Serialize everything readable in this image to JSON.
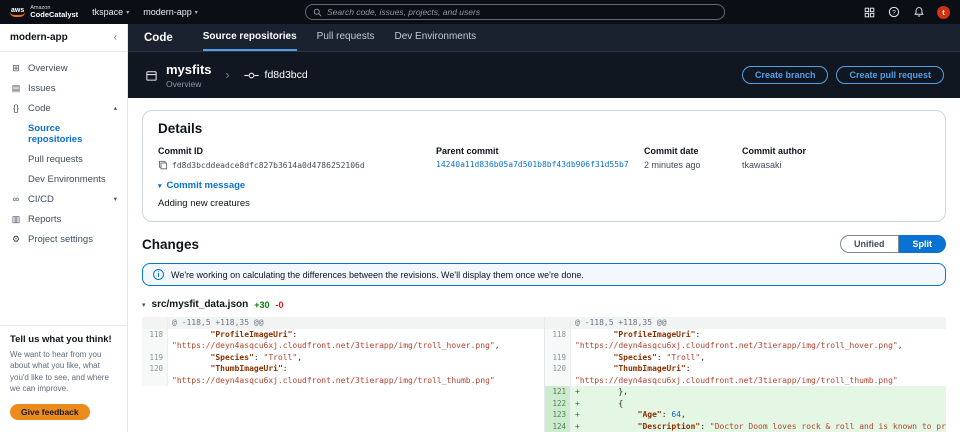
{
  "topbar": {
    "brand_top": "Amazon",
    "brand_bottom": "CodeCatalyst",
    "workspace": "tkspace",
    "project": "modern-app",
    "search_placeholder": "Search code, issues, projects, and users",
    "avatar_letter": "t"
  },
  "icons": {
    "chevron_down": "▾",
    "chevron_up": "▴",
    "collapse_left": "‹",
    "crumb_sep": "›",
    "expander_caret": "▾",
    "info_letter": "i",
    "overview": "⊞",
    "issues": "▤",
    "code": "{}",
    "cicd": "∞",
    "reports": "▥",
    "settings": "⚙"
  },
  "sidebar": {
    "project_name": "modern-app",
    "items": [
      {
        "label": "Overview",
        "icon": "overview"
      },
      {
        "label": "Issues",
        "icon": "issues"
      },
      {
        "label": "Code",
        "icon": "code",
        "caret": "up"
      },
      {
        "label": "Source repositories",
        "indent": true,
        "active": true
      },
      {
        "label": "Pull requests",
        "indent": true
      },
      {
        "label": "Dev Environments",
        "indent": true
      },
      {
        "label": "CI/CD",
        "icon": "cicd",
        "caret": "down"
      },
      {
        "label": "Reports",
        "icon": "reports"
      },
      {
        "label": "Project settings",
        "icon": "settings"
      }
    ],
    "feedback": {
      "title": "Tell us what you think!",
      "body": "We want to hear from you about what you like, what you'd like to see, and where we can improve.",
      "button_label": "Give feedback"
    }
  },
  "tabs": {
    "section_title": "Code",
    "items": [
      {
        "label": "Source repositories",
        "active": true
      },
      {
        "label": "Pull requests",
        "active": false
      },
      {
        "label": "Dev Environments",
        "active": false
      }
    ]
  },
  "repo_header": {
    "repo_name": "mysfits",
    "repo_sub": "Overview",
    "commit_short": "fd8d3bcd",
    "create_branch_label": "Create branch",
    "create_pr_label": "Create pull request"
  },
  "details": {
    "title": "Details",
    "commit_id_label": "Commit ID",
    "commit_id": "fd8d3bcddeadce8dfc827b3614a0d4786252106d",
    "parent_label": "Parent commit",
    "parent_commit": "14240a11d836b05a7d501b8bf43db906f31d55b7",
    "date_label": "Commit date",
    "date_value": "2 minutes ago",
    "author_label": "Commit author",
    "author_value": "tkawasaki",
    "message_toggle_label": "Commit message",
    "message_text": "Adding new creatures"
  },
  "changes": {
    "title": "Changes",
    "unified_label": "Unified",
    "split_label": "Split",
    "alert_text": "We're working on calculating the differences between the revisions. We'll display them once we're done.",
    "file_name": "src/mysfit_data.json",
    "additions": "+30",
    "deletions": "-0"
  },
  "diff": {
    "left_rows": [
      {
        "type": "hunk",
        "text": "@ -118,5 +118,35 @@"
      },
      {
        "type": "ctx",
        "num": "118",
        "segs": [
          {
            "c": "plain",
            "t": "        "
          },
          {
            "c": "key",
            "t": "\"ProfileImageUri\""
          },
          {
            "c": "plain",
            "t": ":"
          }
        ]
      },
      {
        "type": "ctx",
        "num": "",
        "segs": [
          {
            "c": "str",
            "t": "\"https://deyn4asqcu6xj.cloudfront.net/3tierapp/img/troll_hover.png\""
          },
          {
            "c": "plain",
            "t": ","
          }
        ]
      },
      {
        "type": "ctx",
        "num": "119",
        "segs": [
          {
            "c": "plain",
            "t": "        "
          },
          {
            "c": "key",
            "t": "\"Species\""
          },
          {
            "c": "plain",
            "t": ": "
          },
          {
            "c": "str",
            "t": "\"Troll\""
          },
          {
            "c": "plain",
            "t": ","
          }
        ]
      },
      {
        "type": "ctx",
        "num": "120",
        "segs": [
          {
            "c": "plain",
            "t": "        "
          },
          {
            "c": "key",
            "t": "\"ThumbImageUri\""
          },
          {
            "c": "plain",
            "t": ":"
          }
        ]
      },
      {
        "type": "ctx",
        "num": "",
        "segs": [
          {
            "c": "str",
            "t": "\"https://deyn4asqcu6xj.cloudfront.net/3tierapp/img/troll_thumb.png\""
          }
        ]
      }
    ],
    "right_rows": [
      {
        "type": "hunk",
        "text": "@ -118,5 +118,35 @@"
      },
      {
        "type": "ctx",
        "num": "118",
        "segs": [
          {
            "c": "plain",
            "t": "        "
          },
          {
            "c": "key",
            "t": "\"ProfileImageUri\""
          },
          {
            "c": "plain",
            "t": ":"
          }
        ]
      },
      {
        "type": "ctx",
        "num": "",
        "segs": [
          {
            "c": "str",
            "t": "\"https://deyn4asqcu6xj.cloudfront.net/3tierapp/img/troll_hover.png\""
          },
          {
            "c": "plain",
            "t": ","
          }
        ]
      },
      {
        "type": "ctx",
        "num": "119",
        "segs": [
          {
            "c": "plain",
            "t": "        "
          },
          {
            "c": "key",
            "t": "\"Species\""
          },
          {
            "c": "plain",
            "t": ": "
          },
          {
            "c": "str",
            "t": "\"Troll\""
          },
          {
            "c": "plain",
            "t": ","
          }
        ]
      },
      {
        "type": "ctx",
        "num": "120",
        "segs": [
          {
            "c": "plain",
            "t": "        "
          },
          {
            "c": "key",
            "t": "\"ThumbImageUri\""
          },
          {
            "c": "plain",
            "t": ":"
          }
        ]
      },
      {
        "type": "ctx",
        "num": "",
        "segs": [
          {
            "c": "str",
            "t": "\"https://deyn4asqcu6xj.cloudfront.net/3tierapp/img/troll_thumb.png\""
          }
        ]
      },
      {
        "type": "add",
        "num": "121",
        "sign": "+",
        "segs": [
          {
            "c": "plain",
            "t": "        },"
          }
        ]
      },
      {
        "type": "add",
        "num": "122",
        "sign": "+",
        "segs": [
          {
            "c": "plain",
            "t": "        {"
          }
        ]
      },
      {
        "type": "add",
        "num": "123",
        "sign": "+",
        "segs": [
          {
            "c": "plain",
            "t": "            "
          },
          {
            "c": "key",
            "t": "\"Age\""
          },
          {
            "c": "plain",
            "t": ": "
          },
          {
            "c": "num",
            "t": "64"
          },
          {
            "c": "plain",
            "t": ","
          }
        ]
      },
      {
        "type": "add",
        "num": "124",
        "sign": "+",
        "segs": [
          {
            "c": "plain",
            "t": "            "
          },
          {
            "c": "key",
            "t": "\"Description\""
          },
          {
            "c": "plain",
            "t": ": "
          },
          {
            "c": "str",
            "t": "\"Doctor Doom loves rock & roll and is known to prespire under"
          }
        ]
      }
    ]
  },
  "colors": {
    "accent_blue": "#0972d3",
    "dark_blue_link": "#539fe5",
    "added_green_bg": "#e4f6e4",
    "additions_green": "#037f0c",
    "deletions_red": "#d91515",
    "feedback_orange": "#ec8a1b",
    "avatar_red": "#d13212"
  }
}
